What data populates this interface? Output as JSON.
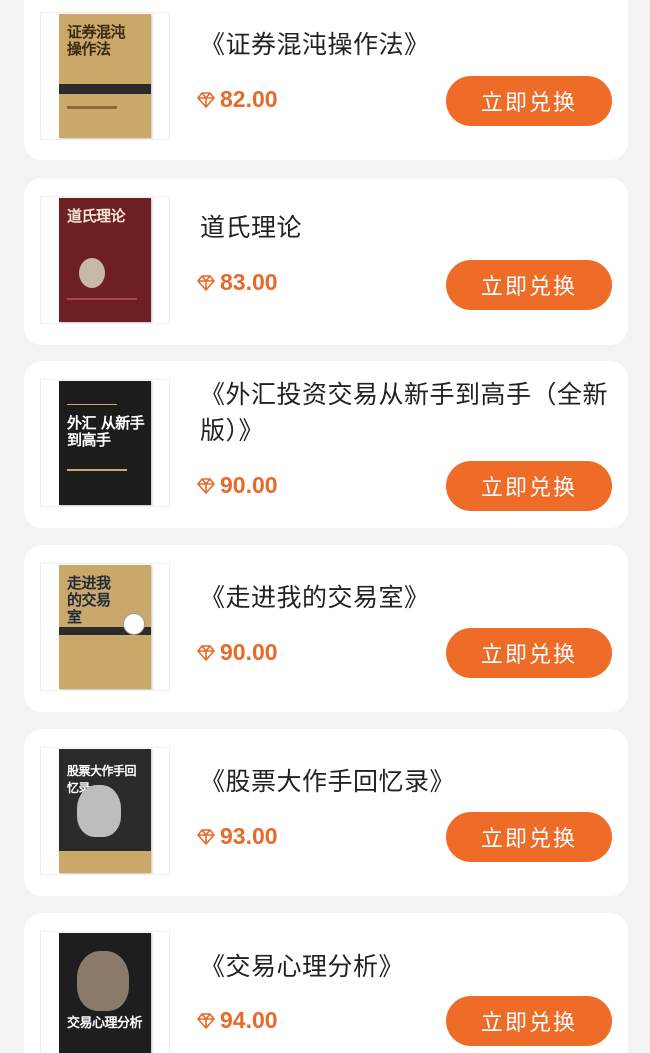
{
  "products": [
    {
      "title": "《证券混沌操作法》",
      "price": "82.00",
      "button": "立即兑换",
      "cover_text": "证券混沌操作法"
    },
    {
      "title": "道氏理论",
      "price": "83.00",
      "button": "立即兑换",
      "cover_text": "道氏理论"
    },
    {
      "title": "《外汇投资交易从新手到高手（全新版）》",
      "price": "90.00",
      "button": "立即兑换",
      "cover_text": "外汇 从新手到高手"
    },
    {
      "title": "《走进我的交易室》",
      "price": "90.00",
      "button": "立即兑换",
      "cover_text": "走进我的交易室"
    },
    {
      "title": "《股票大作手回忆录》",
      "price": "93.00",
      "button": "立即兑换",
      "cover_text": "股票大作手回忆录"
    },
    {
      "title": "《交易心理分析》",
      "price": "94.00",
      "button": "立即兑换",
      "cover_text": "交易心理分析"
    }
  ],
  "icons": {
    "price": "diamond-icon"
  },
  "colors": {
    "accent": "#ee6b28",
    "price": "#e8692a",
    "background": "#f3f3f3",
    "card": "#ffffff"
  }
}
